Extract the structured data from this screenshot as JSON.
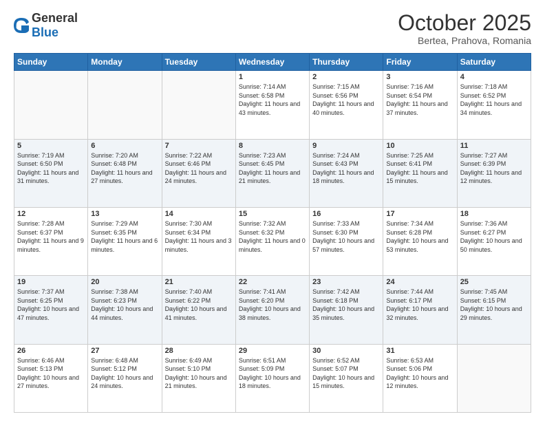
{
  "header": {
    "logo_general": "General",
    "logo_blue": "Blue",
    "month_title": "October 2025",
    "location": "Bertea, Prahova, Romania"
  },
  "days_of_week": [
    "Sunday",
    "Monday",
    "Tuesday",
    "Wednesday",
    "Thursday",
    "Friday",
    "Saturday"
  ],
  "weeks": [
    [
      {
        "day": "",
        "sunrise": "",
        "sunset": "",
        "daylight": ""
      },
      {
        "day": "",
        "sunrise": "",
        "sunset": "",
        "daylight": ""
      },
      {
        "day": "",
        "sunrise": "",
        "sunset": "",
        "daylight": ""
      },
      {
        "day": "1",
        "sunrise": "Sunrise: 7:14 AM",
        "sunset": "Sunset: 6:58 PM",
        "daylight": "Daylight: 11 hours and 43 minutes."
      },
      {
        "day": "2",
        "sunrise": "Sunrise: 7:15 AM",
        "sunset": "Sunset: 6:56 PM",
        "daylight": "Daylight: 11 hours and 40 minutes."
      },
      {
        "day": "3",
        "sunrise": "Sunrise: 7:16 AM",
        "sunset": "Sunset: 6:54 PM",
        "daylight": "Daylight: 11 hours and 37 minutes."
      },
      {
        "day": "4",
        "sunrise": "Sunrise: 7:18 AM",
        "sunset": "Sunset: 6:52 PM",
        "daylight": "Daylight: 11 hours and 34 minutes."
      }
    ],
    [
      {
        "day": "5",
        "sunrise": "Sunrise: 7:19 AM",
        "sunset": "Sunset: 6:50 PM",
        "daylight": "Daylight: 11 hours and 31 minutes."
      },
      {
        "day": "6",
        "sunrise": "Sunrise: 7:20 AM",
        "sunset": "Sunset: 6:48 PM",
        "daylight": "Daylight: 11 hours and 27 minutes."
      },
      {
        "day": "7",
        "sunrise": "Sunrise: 7:22 AM",
        "sunset": "Sunset: 6:46 PM",
        "daylight": "Daylight: 11 hours and 24 minutes."
      },
      {
        "day": "8",
        "sunrise": "Sunrise: 7:23 AM",
        "sunset": "Sunset: 6:45 PM",
        "daylight": "Daylight: 11 hours and 21 minutes."
      },
      {
        "day": "9",
        "sunrise": "Sunrise: 7:24 AM",
        "sunset": "Sunset: 6:43 PM",
        "daylight": "Daylight: 11 hours and 18 minutes."
      },
      {
        "day": "10",
        "sunrise": "Sunrise: 7:25 AM",
        "sunset": "Sunset: 6:41 PM",
        "daylight": "Daylight: 11 hours and 15 minutes."
      },
      {
        "day": "11",
        "sunrise": "Sunrise: 7:27 AM",
        "sunset": "Sunset: 6:39 PM",
        "daylight": "Daylight: 11 hours and 12 minutes."
      }
    ],
    [
      {
        "day": "12",
        "sunrise": "Sunrise: 7:28 AM",
        "sunset": "Sunset: 6:37 PM",
        "daylight": "Daylight: 11 hours and 9 minutes."
      },
      {
        "day": "13",
        "sunrise": "Sunrise: 7:29 AM",
        "sunset": "Sunset: 6:35 PM",
        "daylight": "Daylight: 11 hours and 6 minutes."
      },
      {
        "day": "14",
        "sunrise": "Sunrise: 7:30 AM",
        "sunset": "Sunset: 6:34 PM",
        "daylight": "Daylight: 11 hours and 3 minutes."
      },
      {
        "day": "15",
        "sunrise": "Sunrise: 7:32 AM",
        "sunset": "Sunset: 6:32 PM",
        "daylight": "Daylight: 11 hours and 0 minutes."
      },
      {
        "day": "16",
        "sunrise": "Sunrise: 7:33 AM",
        "sunset": "Sunset: 6:30 PM",
        "daylight": "Daylight: 10 hours and 57 minutes."
      },
      {
        "day": "17",
        "sunrise": "Sunrise: 7:34 AM",
        "sunset": "Sunset: 6:28 PM",
        "daylight": "Daylight: 10 hours and 53 minutes."
      },
      {
        "day": "18",
        "sunrise": "Sunrise: 7:36 AM",
        "sunset": "Sunset: 6:27 PM",
        "daylight": "Daylight: 10 hours and 50 minutes."
      }
    ],
    [
      {
        "day": "19",
        "sunrise": "Sunrise: 7:37 AM",
        "sunset": "Sunset: 6:25 PM",
        "daylight": "Daylight: 10 hours and 47 minutes."
      },
      {
        "day": "20",
        "sunrise": "Sunrise: 7:38 AM",
        "sunset": "Sunset: 6:23 PM",
        "daylight": "Daylight: 10 hours and 44 minutes."
      },
      {
        "day": "21",
        "sunrise": "Sunrise: 7:40 AM",
        "sunset": "Sunset: 6:22 PM",
        "daylight": "Daylight: 10 hours and 41 minutes."
      },
      {
        "day": "22",
        "sunrise": "Sunrise: 7:41 AM",
        "sunset": "Sunset: 6:20 PM",
        "daylight": "Daylight: 10 hours and 38 minutes."
      },
      {
        "day": "23",
        "sunrise": "Sunrise: 7:42 AM",
        "sunset": "Sunset: 6:18 PM",
        "daylight": "Daylight: 10 hours and 35 minutes."
      },
      {
        "day": "24",
        "sunrise": "Sunrise: 7:44 AM",
        "sunset": "Sunset: 6:17 PM",
        "daylight": "Daylight: 10 hours and 32 minutes."
      },
      {
        "day": "25",
        "sunrise": "Sunrise: 7:45 AM",
        "sunset": "Sunset: 6:15 PM",
        "daylight": "Daylight: 10 hours and 29 minutes."
      }
    ],
    [
      {
        "day": "26",
        "sunrise": "Sunrise: 6:46 AM",
        "sunset": "Sunset: 5:13 PM",
        "daylight": "Daylight: 10 hours and 27 minutes."
      },
      {
        "day": "27",
        "sunrise": "Sunrise: 6:48 AM",
        "sunset": "Sunset: 5:12 PM",
        "daylight": "Daylight: 10 hours and 24 minutes."
      },
      {
        "day": "28",
        "sunrise": "Sunrise: 6:49 AM",
        "sunset": "Sunset: 5:10 PM",
        "daylight": "Daylight: 10 hours and 21 minutes."
      },
      {
        "day": "29",
        "sunrise": "Sunrise: 6:51 AM",
        "sunset": "Sunset: 5:09 PM",
        "daylight": "Daylight: 10 hours and 18 minutes."
      },
      {
        "day": "30",
        "sunrise": "Sunrise: 6:52 AM",
        "sunset": "Sunset: 5:07 PM",
        "daylight": "Daylight: 10 hours and 15 minutes."
      },
      {
        "day": "31",
        "sunrise": "Sunrise: 6:53 AM",
        "sunset": "Sunset: 5:06 PM",
        "daylight": "Daylight: 10 hours and 12 minutes."
      },
      {
        "day": "",
        "sunrise": "",
        "sunset": "",
        "daylight": ""
      }
    ]
  ]
}
